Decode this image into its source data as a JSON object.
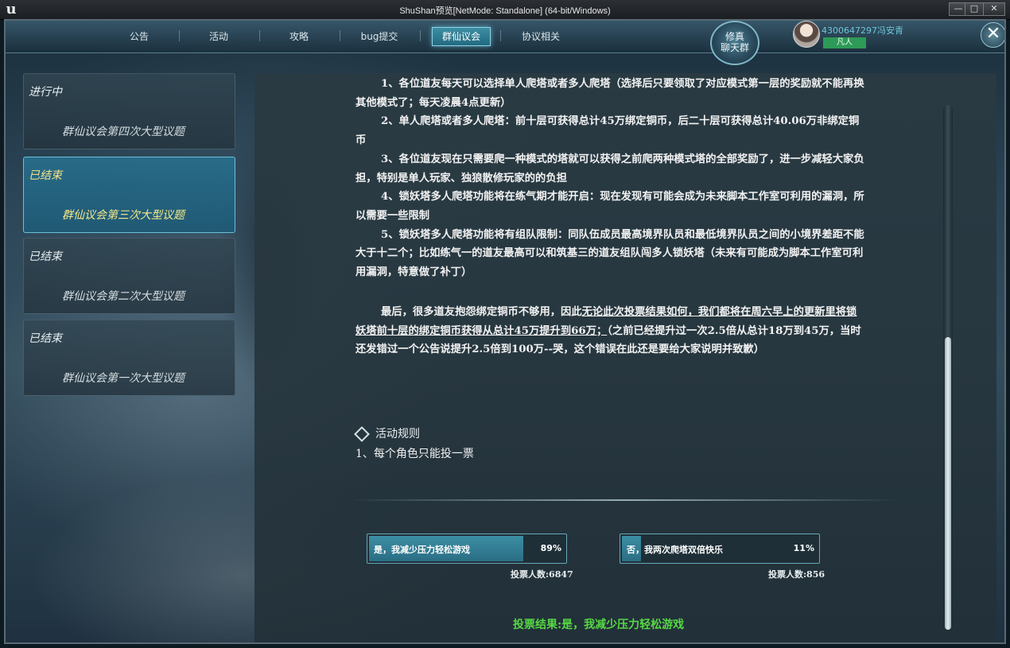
{
  "window": {
    "title": "ShuShan预览[NetMode: Standalone]  (64-bit/Windows)",
    "logo": "ue-logo-icon",
    "min_glyph": "—",
    "max_glyph": "□",
    "close_glyph": "✕"
  },
  "nav": {
    "tabs": [
      {
        "label": "公告"
      },
      {
        "label": "活动"
      },
      {
        "label": "攻略"
      },
      {
        "label": "bug提交"
      },
      {
        "label": "群仙议会",
        "active": true
      },
      {
        "label": "协议相关"
      }
    ],
    "chat_badge": "修真\n聊天群",
    "username": "4300647297冯安青",
    "rank": "凡人",
    "close_glyph": "✕"
  },
  "topics": [
    {
      "status": "进行中",
      "name": "群仙议会第四次大型议题",
      "selected": false
    },
    {
      "status": "已结束",
      "name": "群仙议会第三次大型议题",
      "selected": true
    },
    {
      "status": "已结束",
      "name": "群仙议会第二次大型议题",
      "selected": false
    },
    {
      "status": "已结束",
      "name": "群仙议会第一次大型议题",
      "selected": false
    }
  ],
  "content": {
    "items": [
      "1、各位道友每天可以选择单人爬塔或者多人爬塔（选择后只要领取了对应模式第一层的奖励就不能再换其他模式了；每天凌晨4点更新）",
      "2、单人爬塔或者多人爬塔：前十层可获得总计45万绑定铜币，后二十层可获得总计40.06万非绑定铜币",
      "3、各位道友现在只需要爬一种模式的塔就可以获得之前爬两种模式塔的全部奖励了，进一步减轻大家负担，特别是单人玩家、独狼散修玩家的的负担",
      "4、锁妖塔多人爬塔功能将在练气期才能开启：现在发现有可能会成为未来脚本工作室可利用的漏洞，所以需要一些限制",
      "5、锁妖塔多人爬塔功能将有组队限制：同队伍成员最高境界队员和最低境界队员之间的小境界差距不能大于十二个；比如练气一的道友最高可以和筑基三的道友组队闯多人锁妖塔（未来有可能成为脚本工作室可利用漏洞，特意做了补丁）"
    ],
    "final_prefix": "最后，很多道友抱怨绑定铜币不够用，因此",
    "final_underline": "无论此次投票结果如何，我们都将在周六早上的更新里将锁妖塔前十层的绑定铜币获得从总计45万提升到66万；",
    "final_suffix": "（之前已经提升过一次2.5倍从总计18万到45万，当时还发错过一个公告说提升2.5倍到100万--哭，这个错误在此还是要给大家说明并致歉）",
    "rules_title": "活动规则",
    "rules": [
      "1、每个角色只能投一票"
    ],
    "votes": [
      {
        "label": "是，我减少压力轻松游戏",
        "percent": "89%",
        "fraction": 0.89,
        "count": "投票人数:6847"
      },
      {
        "label": "否，我两次爬塔双倍快乐",
        "percent": "11%",
        "fraction": 0.11,
        "count": "投票人数:856"
      }
    ],
    "result": "投票结果:是，我减少压力轻松游戏"
  }
}
